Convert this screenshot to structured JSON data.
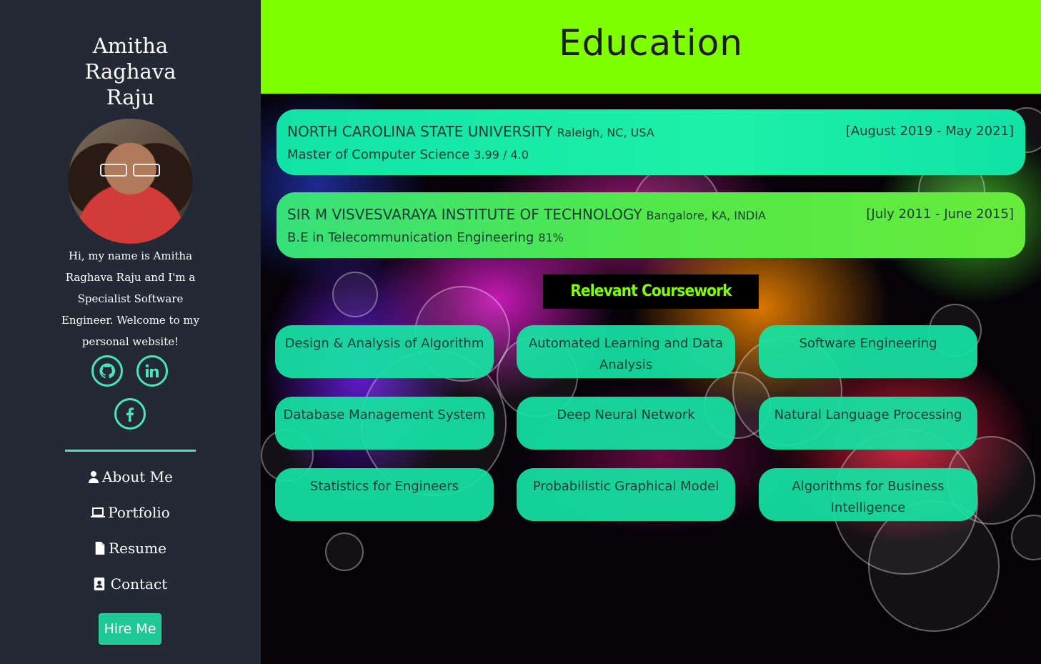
{
  "sidebar": {
    "name_lines": [
      "Amitha",
      "Raghava",
      "Raju"
    ],
    "intro": "Hi, my name is Amitha Raghava Raju and I'm a Specialist Software Engineer. Welcome to my personal website!",
    "social_icons": [
      "github-icon",
      "linkedin-icon",
      "facebook-icon"
    ],
    "nav": [
      {
        "label": "About Me",
        "icon": "user-icon"
      },
      {
        "label": "Portfolio",
        "icon": "laptop-icon"
      },
      {
        "label": "Resume",
        "icon": "file-icon"
      },
      {
        "label": "Contact",
        "icon": "address-book-icon"
      }
    ],
    "hire_label": "Hire Me",
    "accent_color": "#49e6b8"
  },
  "main": {
    "title": "Education",
    "header_color": "#7fff00",
    "education": [
      {
        "school": "NORTH CAROLINA STATE UNIVERSITY",
        "location": "Raleigh, NC, USA",
        "dates": "[August 2019 - May 2021]",
        "degree": "Master of Computer Science",
        "grade": "3.99 / 4.0"
      },
      {
        "school": "SIR M VISVESVARAYA INSTITUTE OF TECHNOLOGY",
        "location": "Bangalore, KA, INDIA",
        "dates": "[July 2011 - June 2015]",
        "degree": "B.E in Telecommunication Engineering",
        "grade": "81%"
      }
    ],
    "coursework_title": "Relevant Coursework",
    "courses": [
      "Design & Analysis of Algorithm",
      "Automated Learning and Data Analysis",
      "Software Engineering",
      "Database Management System",
      "Deep Neural Network",
      "Natural Language Processing",
      "Statistics for Engineers",
      "Probabilistic Graphical Model",
      "Algorithms for Business Intelligence"
    ]
  }
}
